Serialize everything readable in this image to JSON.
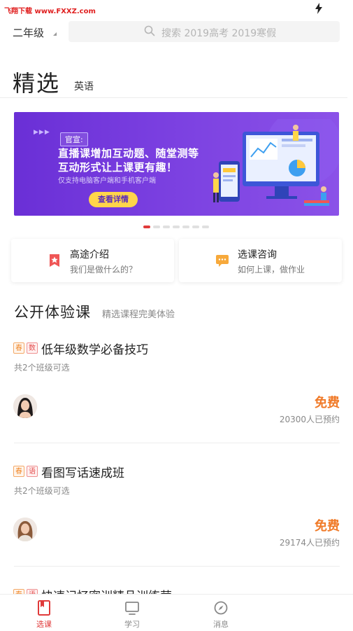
{
  "status_bar": {
    "watermark": "飞翔下载 www.FXXZ.com"
  },
  "header": {
    "grade": "二年级",
    "search_placeholder": "搜索 2019高考 2019寒假",
    "title": "精选",
    "subject_tab": "英语"
  },
  "banner": {
    "tag": "官宣:",
    "line1": "直播课增加互动题、随堂测等",
    "line2": "互动形式让上课更有趣！",
    "note": "仅支持电脑客户端和手机客户端",
    "button": "查看详情",
    "slide_count": 7,
    "active_slide": 0
  },
  "cards": [
    {
      "title": "高途介绍",
      "subtitle": "我们是做什么的？",
      "icon": "bookmark-star-icon",
      "color": "#ef5656"
    },
    {
      "title": "选课咨询",
      "subtitle": "如何上课，做作业",
      "icon": "chat-bubble-icon",
      "color": "#f7a93b"
    }
  ],
  "section": {
    "title": "公开体验课",
    "subtitle": "精选课程完美体验"
  },
  "courses": [
    {
      "season_tag": "春",
      "subject_tag": "数",
      "title": "低年级数学必备技巧",
      "classes": "共2个班级可选",
      "price": "免费",
      "booked": "20300人已预约"
    },
    {
      "season_tag": "春",
      "subject_tag": "语",
      "title": "看图写话速成班",
      "classes": "共2个班级可选",
      "price": "免费",
      "booked": "29174人已预约"
    },
    {
      "season_tag": "春",
      "subject_tag": "语",
      "title": "快速记忆密训精品训练营"
    }
  ],
  "bottom_nav": [
    {
      "label": "选课",
      "icon": "book-icon",
      "active": true
    },
    {
      "label": "学习",
      "icon": "monitor-icon",
      "active": false
    },
    {
      "label": "消息",
      "icon": "compass-icon",
      "active": false
    }
  ],
  "colors": {
    "accent": "#e03a3a",
    "price": "#f07a28",
    "banner": "#7a3fe0"
  }
}
